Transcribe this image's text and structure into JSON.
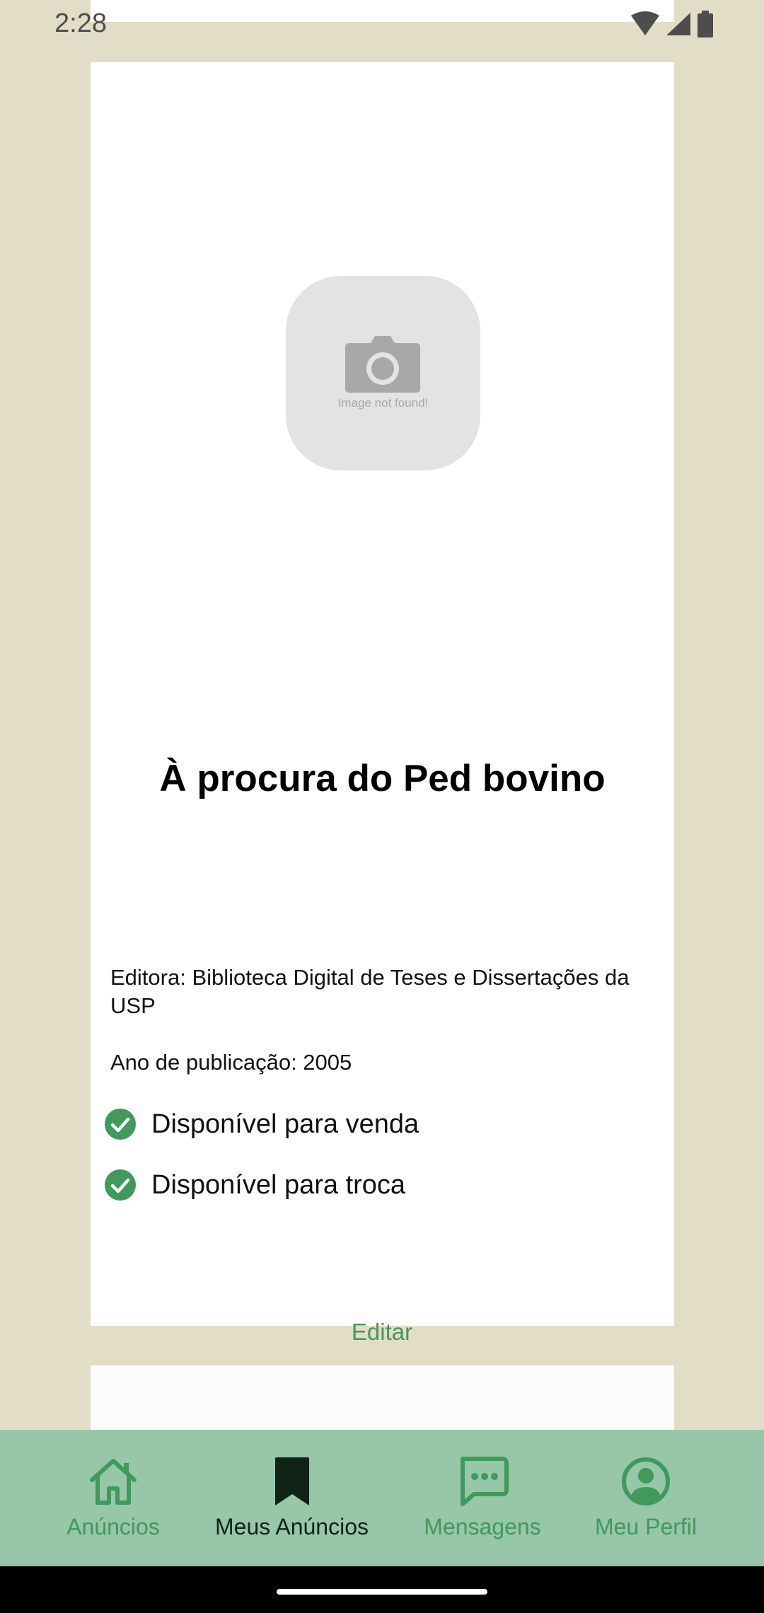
{
  "status_bar": {
    "time": "2:28"
  },
  "listing": {
    "image_placeholder_text": "Image not found!",
    "title": "À procura do Ped bovino",
    "publisher": "Editora: Biblioteca Digital de Teses e Dissertações da USP",
    "publication_year": "Ano de publicação: 2005",
    "availability": [
      {
        "label": "Disponível para venda",
        "checked": true
      },
      {
        "label": "Disponível para troca",
        "checked": true
      }
    ],
    "edit_label": "Editar"
  },
  "bottom_nav": {
    "items": [
      {
        "label": "Anúncios",
        "icon": "home-icon",
        "active": false
      },
      {
        "label": "Meus Anúncios",
        "icon": "bookmark-icon",
        "active": true
      },
      {
        "label": "Mensagens",
        "icon": "chat-icon",
        "active": false
      },
      {
        "label": "Meu Perfil",
        "icon": "profile-icon",
        "active": false
      }
    ]
  },
  "colors": {
    "background": "#e2ddc7",
    "card": "#ffffff",
    "accent_green": "#3f9a5b",
    "nav_background": "#97c6a9",
    "nav_active": "#0f2417",
    "check_green": "#3f9a5b"
  }
}
